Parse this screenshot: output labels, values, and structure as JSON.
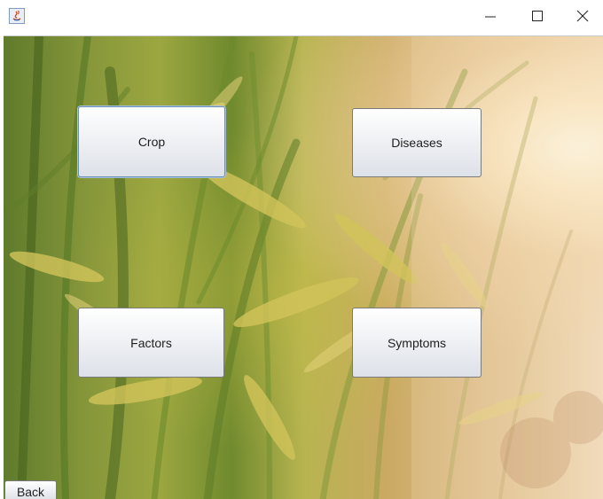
{
  "window": {
    "icon": "java-icon",
    "controls": {
      "minimize": "minimize-icon",
      "maximize": "maximize-icon",
      "close": "close-icon"
    }
  },
  "menu": {
    "crop_label": "Crop",
    "diseases_label": "Diseases",
    "factors_label": "Factors",
    "symptoms_label": "Symptoms"
  },
  "footer": {
    "back_label": "Back"
  },
  "background": {
    "description_colors": {
      "foliage": "#6f8a2e",
      "grain": "#c9b64e",
      "glow": "#fff6e2"
    }
  }
}
